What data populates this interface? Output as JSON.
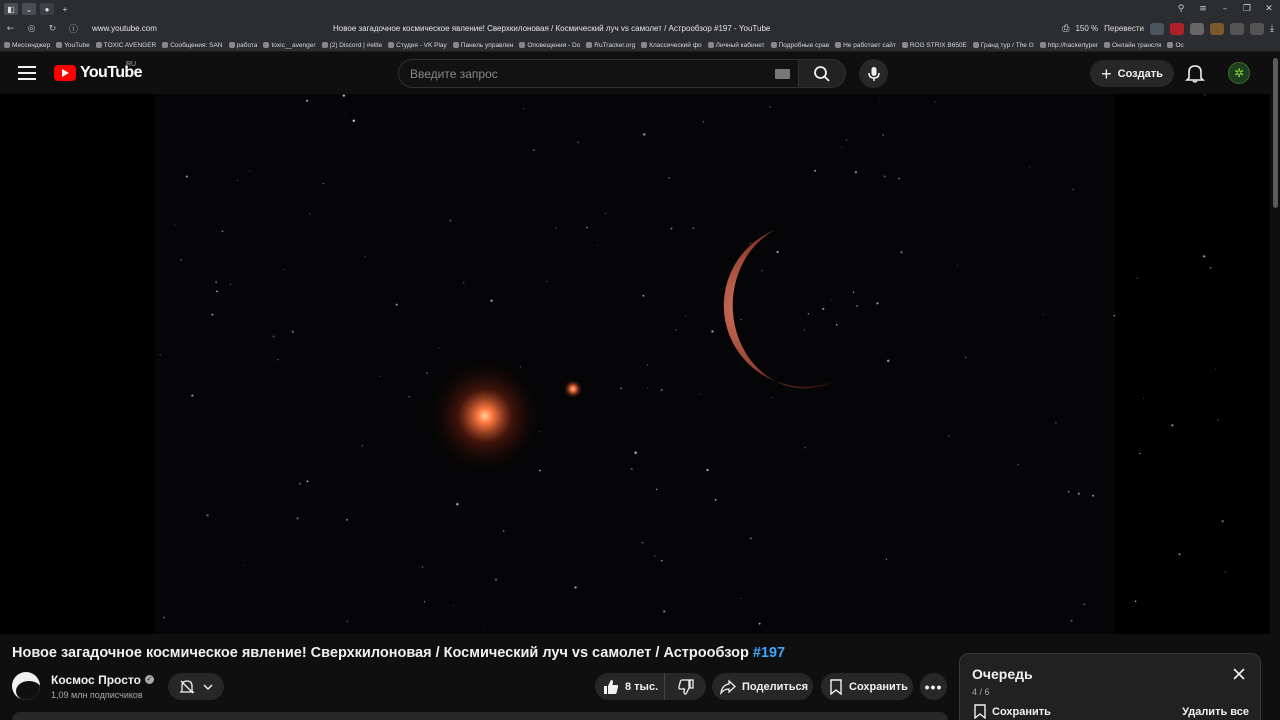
{
  "browser": {
    "url": "www.youtube.com",
    "page_title": "Новое загадочное космическое явление! Сверхкилоновая / Космический луч vs самолет / Астрообзор #197 - YouTube",
    "zoom": "150 %",
    "translate_label": "Перевести",
    "bookmarks": [
      "Мессенджер",
      "YouTube",
      "TOXIC AVENGER",
      "Сообщения: SAN",
      "работа",
      "toxic__avenger",
      "(2) Discord | #elite",
      "Студия - VK Play",
      "Панель управлен",
      "Оповещения - Do",
      "RuTracker.org",
      "Классический фо",
      "Личный кабинет",
      "Подробные срав",
      "Не работает сайт",
      "ROG STRIX B650E",
      "Гранд тур / The G",
      "http://hackertyper",
      "Онлайн трансля",
      "Ос"
    ]
  },
  "youtube": {
    "region": "RU",
    "logo_text": "YouTube",
    "search_placeholder": "Введите запрос",
    "create_label": "Создать"
  },
  "video": {
    "title": "Новое загадочное космическое явление! Сверхкилоновая / Космический луч vs самолет / Астрообзор",
    "hashtag": "#197",
    "channel_name": "Космос Просто",
    "subscribers": "1,09 млн подписчиков",
    "likes": "8 тыс.",
    "share_label": "Поделиться",
    "save_label": "Сохранить"
  },
  "queue": {
    "title": "Очередь",
    "counter": "4 / 6",
    "save_label": "Сохранить",
    "delete_all_label": "Удалить все"
  },
  "icons": [
    "menu-icon",
    "search-icon",
    "mic-icon",
    "plus-icon",
    "bell-icon",
    "avatar-icon",
    "like-icon",
    "dislike-icon",
    "share-icon",
    "save-icon",
    "more-icon",
    "close-icon",
    "verified-icon",
    "bell-off-icon",
    "chevron-down-icon"
  ],
  "colors": {
    "brand_red": "#ff0000",
    "hashtag": "#3ea6ff",
    "background": "#0f0f0f"
  }
}
